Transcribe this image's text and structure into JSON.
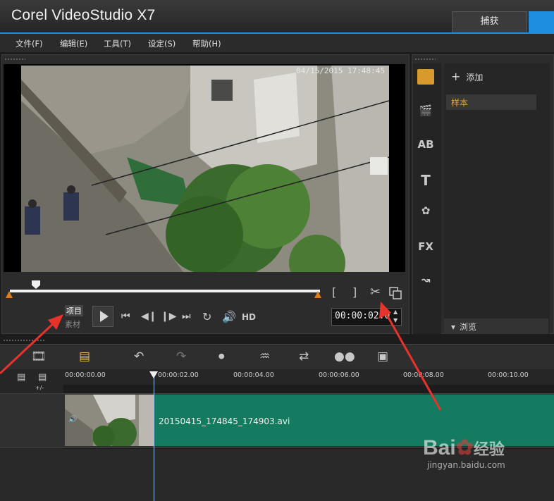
{
  "app": {
    "title": "Corel VideoStudio X7"
  },
  "tabs": {
    "capture": "捕获"
  },
  "menu": [
    "文件(F)",
    "编辑(E)",
    "工具(T)",
    "设定(S)",
    "帮助(H)"
  ],
  "preview": {
    "timestamp": "04/15/2015 17:48:45"
  },
  "player": {
    "mode_project": "项目",
    "mode_clip": "素材",
    "hd_label": "HD",
    "timecode": "00:00:02.0",
    "mark_in": "[",
    "mark_out": "]"
  },
  "library": {
    "add_label": "添加",
    "sample_label": "样本",
    "browse_label": "浏览"
  },
  "timeline": {
    "ticks": [
      "00:00:00.00",
      "00:00:02.00",
      "00:00:04.00",
      "00:00:06.00",
      "00:00:08.00",
      "00:00:10.00"
    ],
    "zoom_label": "+/-",
    "clip_name": "20150415_174845_174903.avi"
  },
  "watermark": {
    "brand": "Bai",
    "brand_cn": "经验",
    "url": "jingyan.baidu.com"
  },
  "colors": {
    "accent": "#1e8ee0",
    "clip": "#147a60",
    "trim": "#e07a18",
    "annotation": "#e8322c"
  }
}
